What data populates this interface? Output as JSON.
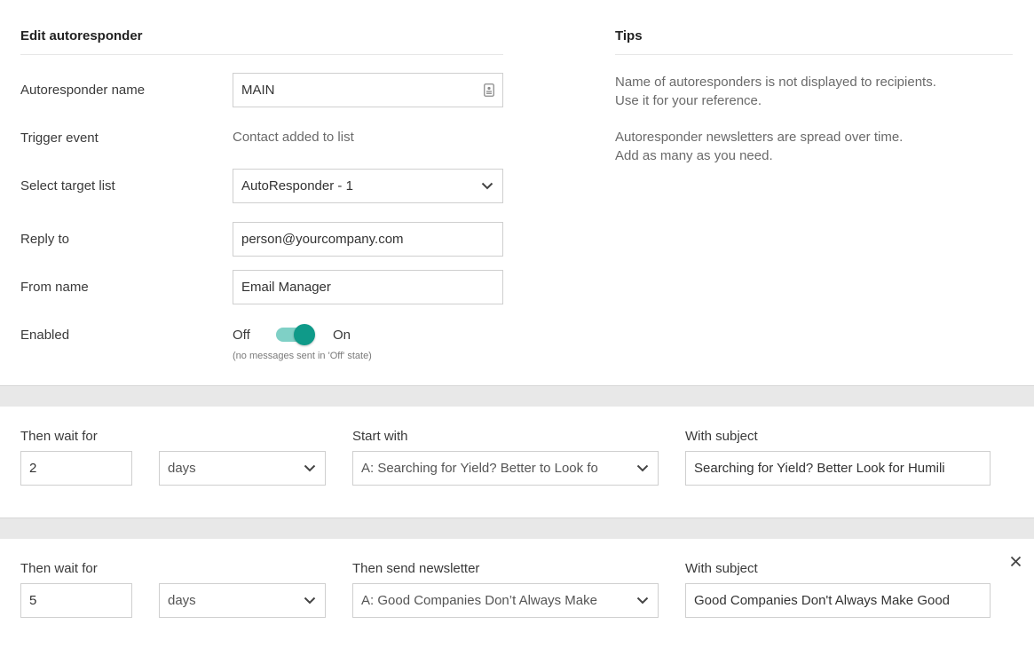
{
  "edit": {
    "title": "Edit autoresponder",
    "name_label": "Autoresponder name",
    "name_value": "MAIN",
    "trigger_label": "Trigger event",
    "trigger_value": "Contact added to list",
    "target_label": "Select target list",
    "target_value": "AutoResponder - 1",
    "reply_label": "Reply to",
    "reply_value": "person@yourcompany.com",
    "from_label": "From name",
    "from_value": "Email Manager",
    "enabled_label": "Enabled",
    "toggle_off": "Off",
    "toggle_on": "On",
    "toggle_state": "on",
    "toggle_note": "(no messages sent in 'Off' state)"
  },
  "tips": {
    "title": "Tips",
    "line1": "Name of autoresponders is not displayed to recipients.",
    "line2": "Use it for your reference.",
    "line3": "Autoresponder newsletters are spread over time.",
    "line4": "Add as many as you need."
  },
  "steps": [
    {
      "wait_label": "Then wait for",
      "wait_value": "2",
      "unit_value": "days",
      "newsletter_label": "Start with",
      "newsletter_value": "A: Searching for Yield? Better to Look fo",
      "subject_label": "With subject",
      "subject_value": "Searching for Yield?  Better Look for Humili"
    },
    {
      "wait_label": "Then wait for",
      "wait_value": "5",
      "unit_value": "days",
      "newsletter_label": "Then send newsletter",
      "newsletter_value": "A: Good Companies Don’t Always Make",
      "subject_label": "With subject",
      "subject_value": "Good Companies Don't Always Make Good"
    }
  ],
  "colors": {
    "accent": "#0f9a89",
    "accent_light": "#7fd0c6",
    "band": "#e8e8e8"
  }
}
